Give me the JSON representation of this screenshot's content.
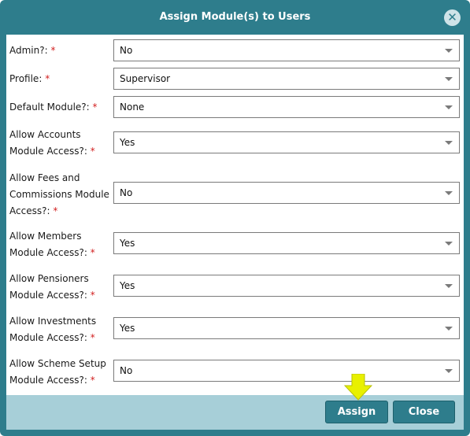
{
  "dialog": {
    "title": "Assign Module(s) to Users",
    "close_glyph": "✕",
    "required_mark": "*"
  },
  "fields": [
    {
      "label": "Admin?:",
      "value": "No"
    },
    {
      "label": "Profile:",
      "value": "Supervisor"
    },
    {
      "label": "Default Module?:",
      "value": "None"
    },
    {
      "label": "Allow Accounts Module Access?:",
      "value": "Yes"
    },
    {
      "label": "Allow Fees and Commissions Module Access?:",
      "value": "No"
    },
    {
      "label": "Allow Members Module Access?:",
      "value": "Yes"
    },
    {
      "label": "Allow Pensioners Module Access?:",
      "value": "Yes"
    },
    {
      "label": "Allow Investments Module Access?:",
      "value": "Yes"
    },
    {
      "label": "Allow Scheme Setup Module Access?:",
      "value": "No"
    }
  ],
  "buttons": {
    "assign": "Assign",
    "close": "Close"
  },
  "colors": {
    "header": "#2e7d8c",
    "footer": "#a7cfd8",
    "required": "#d21f1f",
    "highlight_arrow": "#e8f000"
  },
  "icons": [
    "close-icon",
    "chevron-down-icon",
    "pointer-arrow-icon"
  ]
}
